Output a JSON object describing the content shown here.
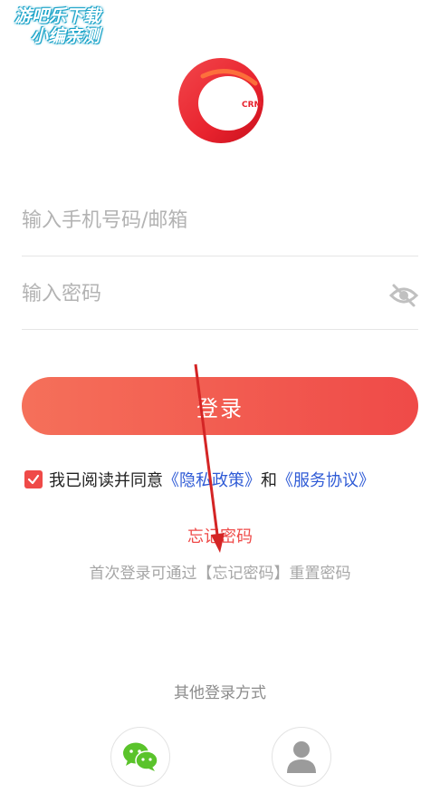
{
  "watermark": {
    "line1": "游吧乐下载",
    "line2": "小编亲测"
  },
  "logo": {
    "text": "CRM"
  },
  "form": {
    "phone_placeholder": "输入手机号码/邮箱",
    "password_placeholder": "输入密码",
    "login_label": "登录"
  },
  "agreement": {
    "checked": true,
    "text": "我已阅读并同意",
    "privacy_link": "《隐私政策》",
    "and": "和",
    "service_link": "《服务协议》"
  },
  "forgot_password": "忘记密码",
  "hint": "首次登录可通过【忘记密码】重置密码",
  "other_login": {
    "title": "其他登录方式",
    "options": [
      {
        "icon": "wechat-icon",
        "color": "#5ac32b"
      },
      {
        "icon": "account-icon",
        "color": "#9b9b9b"
      }
    ]
  },
  "colors": {
    "accent": "#ef4a48",
    "link": "#2f5bd6"
  }
}
